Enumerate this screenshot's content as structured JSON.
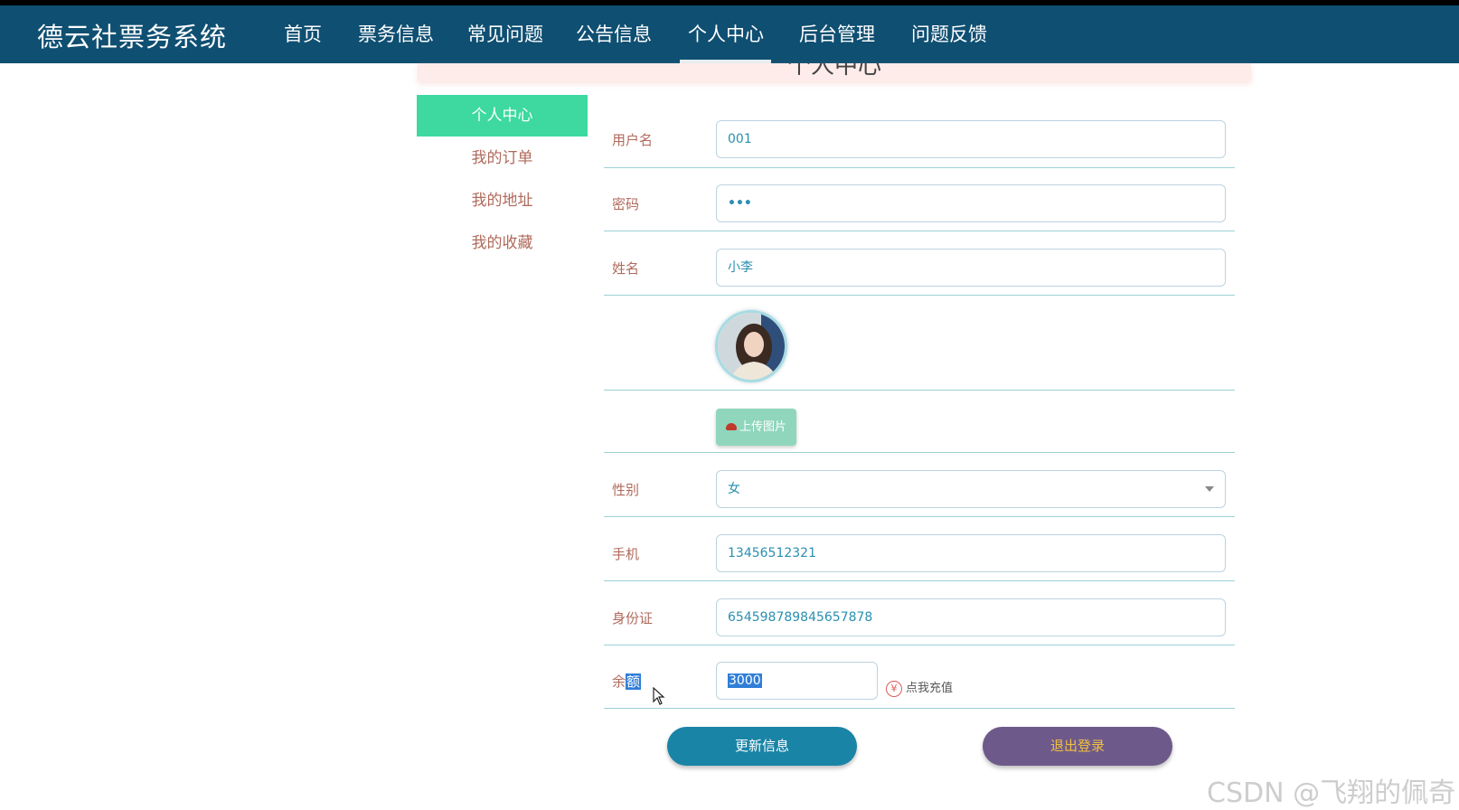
{
  "header": {
    "brand": "德云社票务系统",
    "nav": [
      {
        "label": "首页"
      },
      {
        "label": "票务信息"
      },
      {
        "label": "常见问题"
      },
      {
        "label": "公告信息"
      },
      {
        "label": "个人中心",
        "active": true
      },
      {
        "label": "后台管理"
      },
      {
        "label": "问题反馈"
      }
    ]
  },
  "banner": {
    "title": "个人中心"
  },
  "sidebar": {
    "items": [
      {
        "label": "个人中心",
        "active": true
      },
      {
        "label": "我的订单"
      },
      {
        "label": "我的地址"
      },
      {
        "label": "我的收藏"
      }
    ]
  },
  "form": {
    "username": {
      "label": "用户名",
      "value": "001"
    },
    "password": {
      "label": "密码",
      "value": "•••"
    },
    "name": {
      "label": "姓名",
      "value": "小李"
    },
    "upload_label": "上传图片",
    "gender": {
      "label": "性别",
      "value": "女"
    },
    "phone": {
      "label": "手机",
      "value": "13456512321"
    },
    "id_card": {
      "label": "身份证",
      "value": "654598789845657878"
    },
    "balance": {
      "label_prefix": "余",
      "label_selected": "额",
      "value": "3000"
    },
    "recharge_label": "点我充值",
    "recharge_icon": "¥"
  },
  "actions": {
    "update": "更新信息",
    "logout": "退出登录"
  },
  "watermark": "CSDN @飞翔的佩奇",
  "colors": {
    "nav_bg": "#0f4f72",
    "sidebar_active": "#3dd9a0",
    "update_btn": "#1a84a6",
    "logout_btn": "#6e5a8a"
  }
}
